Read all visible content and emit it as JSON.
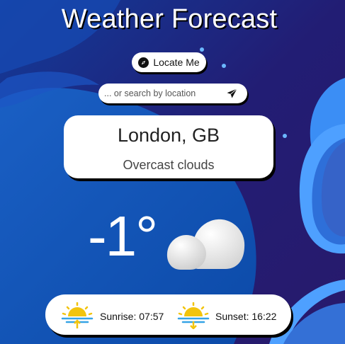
{
  "app": {
    "title": "Weather Forecast"
  },
  "controls": {
    "locate_label": "Locate Me",
    "search_placeholder": "... or search by location",
    "search_value": ""
  },
  "location": {
    "city": "London, GB",
    "condition": "Overcast clouds"
  },
  "current": {
    "temperature": "-1°",
    "icon": "overcast-cloud-icon"
  },
  "sun": {
    "sunrise_label": "Sunrise: 07:57",
    "sunset_label": "Sunset: 16:22",
    "sunrise_icon": "sunrise-icon",
    "sunset_icon": "sunset-icon"
  },
  "colors": {
    "background": "#1f1b6b",
    "accent_blue": "#3b8ef5",
    "sun_yellow": "#f2c40d",
    "water_blue": "#36a3e6"
  }
}
